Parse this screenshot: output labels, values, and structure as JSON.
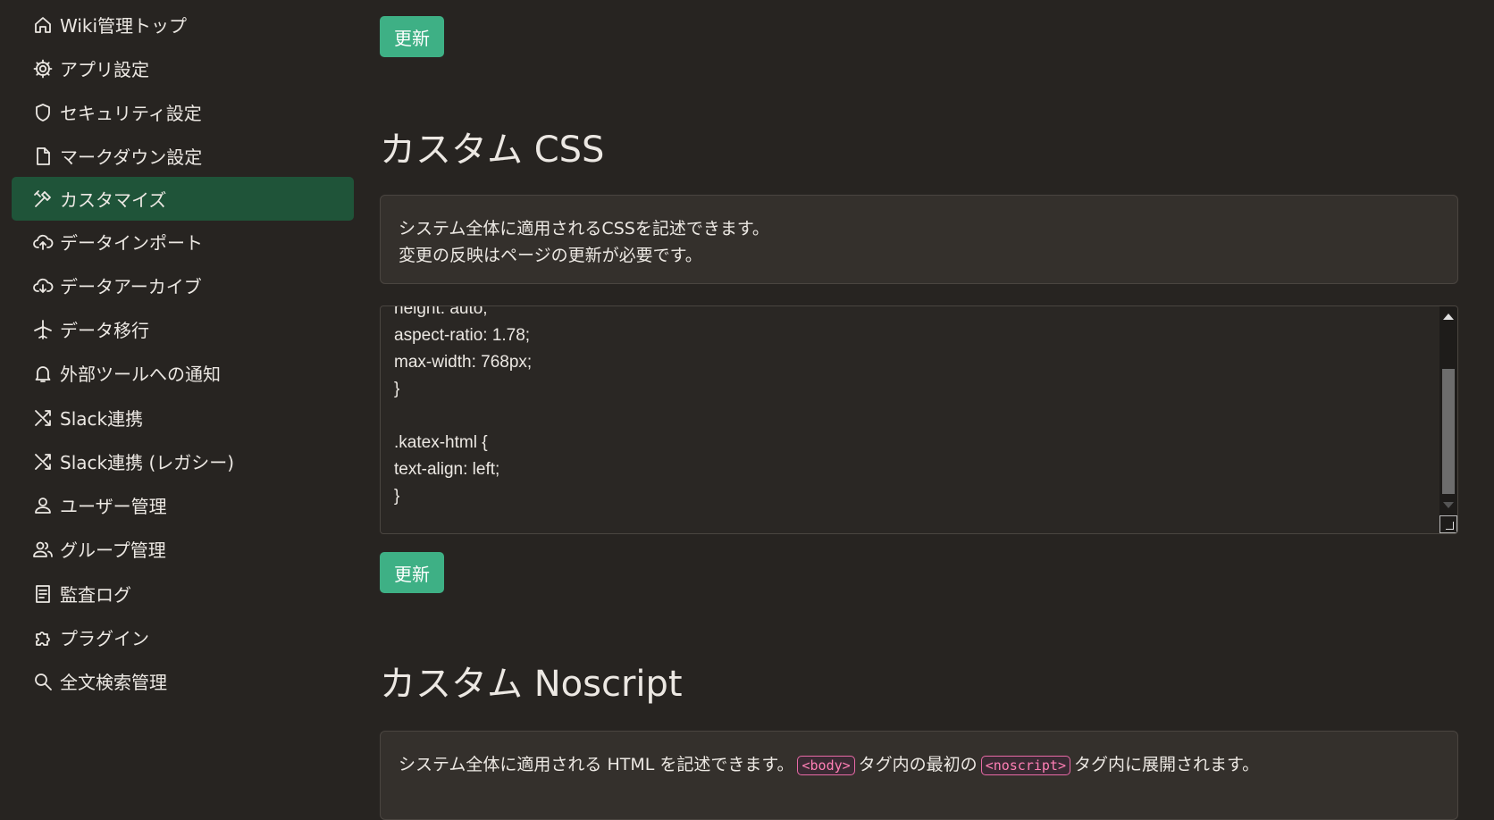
{
  "sidebar": {
    "items": [
      {
        "label": "Wiki管理トップ",
        "icon": "home-icon"
      },
      {
        "label": "アプリ設定",
        "icon": "gear-icon"
      },
      {
        "label": "セキュリティ設定",
        "icon": "shield-icon"
      },
      {
        "label": "マークダウン設定",
        "icon": "file-icon"
      },
      {
        "label": "カスタマイズ",
        "icon": "tools-icon",
        "active": true
      },
      {
        "label": "データインポート",
        "icon": "cloud-upload-icon"
      },
      {
        "label": "データアーカイブ",
        "icon": "cloud-download-icon"
      },
      {
        "label": "データ移行",
        "icon": "airplane-icon"
      },
      {
        "label": "外部ツールへの通知",
        "icon": "bell-icon"
      },
      {
        "label": "Slack連携",
        "icon": "shuffle-icon"
      },
      {
        "label": "Slack連携 (レガシー)",
        "icon": "shuffle-icon"
      },
      {
        "label": "ユーザー管理",
        "icon": "user-icon"
      },
      {
        "label": "グループ管理",
        "icon": "group-icon"
      },
      {
        "label": "監査ログ",
        "icon": "document-list-icon"
      },
      {
        "label": "プラグイン",
        "icon": "puzzle-icon"
      },
      {
        "label": "全文検索管理",
        "icon": "search-icon"
      }
    ]
  },
  "main": {
    "update_button_top": "更新",
    "css_section": {
      "title": "カスタム CSS",
      "description_lines": [
        "システム全体に適用されるCSSを記述できます。",
        "変更の反映はページの更新が必要です。"
      ],
      "editor_lines": [
        "height: auto;",
        "aspect-ratio: 1.78;",
        "max-width: 768px;",
        "}",
        "",
        ".katex-html {",
        "text-align: left;",
        "}"
      ],
      "update_button": "更新"
    },
    "noscript_section": {
      "title": "カスタム Noscript",
      "description_prefix": "システム全体に適用される HTML を記述できます。",
      "tag_body": "<body>",
      "description_middle": "タグ内の最初の",
      "tag_noscript": "<noscript>",
      "description_suffix": "タグ内に展開されます。"
    }
  },
  "colors": {
    "background": "#272421",
    "active_nav": "#1f5439",
    "button": "#3eb085",
    "tag": "#ff7fb5"
  }
}
